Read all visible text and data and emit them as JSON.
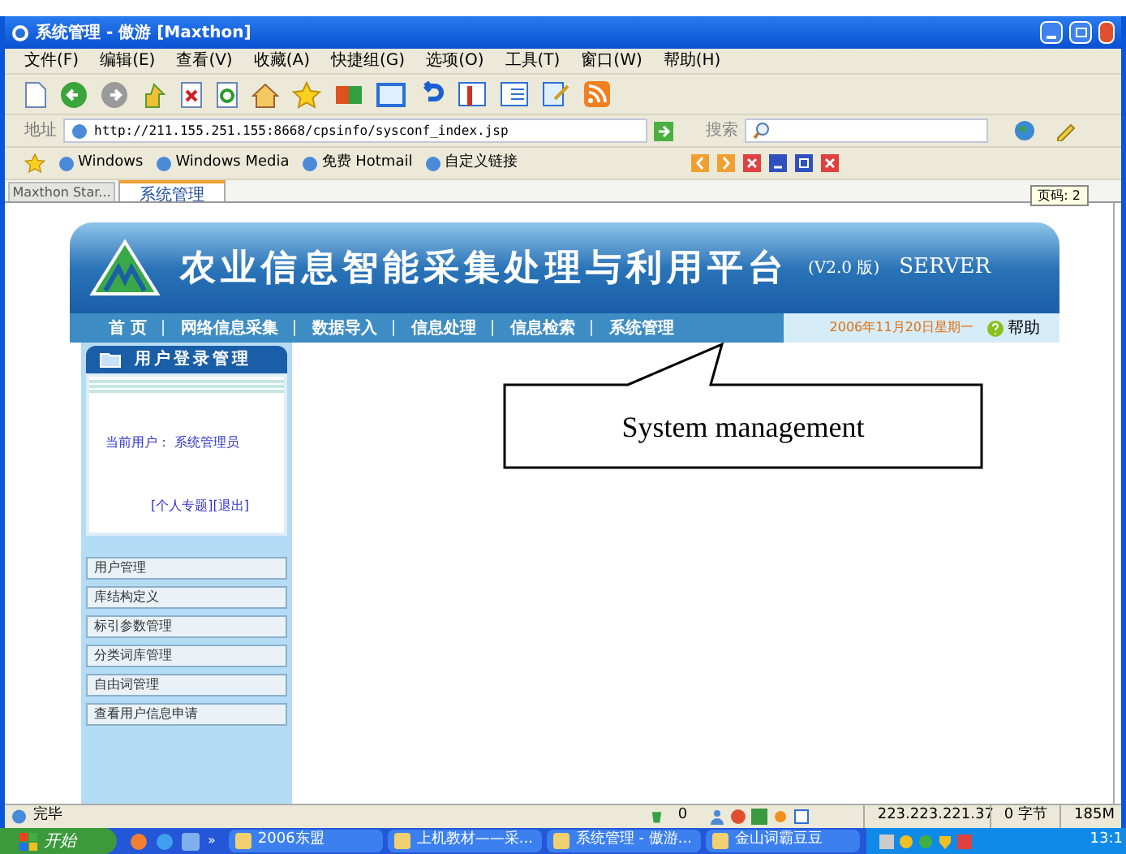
{
  "window": {
    "title": "系统管理 - 傲游 [Maxthon]"
  },
  "menu": [
    "文件(F)",
    "编辑(E)",
    "查看(V)",
    "收藏(A)",
    "快捷组(G)",
    "选项(O)",
    "工具(T)",
    "窗口(W)",
    "帮助(H)"
  ],
  "address_bar": {
    "label": "地址",
    "value": "http://211.155.251.155:8668/cpsinfo/sysconf_index.jsp"
  },
  "search": {
    "label": "搜索"
  },
  "favorites": [
    "Windows",
    "Windows Media",
    "免费 Hotmail",
    "自定义链接"
  ],
  "tabs": [
    {
      "label": "Maxthon Star...",
      "selected": false
    },
    {
      "label": "系统管理",
      "selected": true
    }
  ],
  "tooltip": "页码: 2",
  "page": {
    "title": "农业信息智能采集处理与利用平台",
    "version": "(V2.0 版)",
    "edition": "SERVER",
    "nav": [
      "首 页",
      "网络信息采集",
      "数据导入",
      "信息处理",
      "信息检索",
      "系统管理"
    ],
    "date": "2006年11月20日星期一",
    "help": "帮助",
    "login_panel": {
      "title": "用户登录管理",
      "current_user": "当前用户： 系统管理员",
      "links": [
        "[个人专题]",
        "[退出]"
      ]
    },
    "sidebar_items": [
      "用户管理",
      "库结构定义",
      "标引参数管理",
      "分类词库管理",
      "自由词管理",
      "查看用户信息申请"
    ]
  },
  "callout": "System management",
  "status_bar": {
    "text": "完毕",
    "count": "0",
    "ip": "223.223.221.37",
    "bytes": "0 字节",
    "memory": "185M"
  },
  "taskbar": {
    "start": "开始",
    "more": "»",
    "tasks": [
      "2006东盟",
      "上机教材——采...",
      "系统管理 - 傲游...",
      "金山词霸豆豆"
    ],
    "clock": "13:1"
  }
}
